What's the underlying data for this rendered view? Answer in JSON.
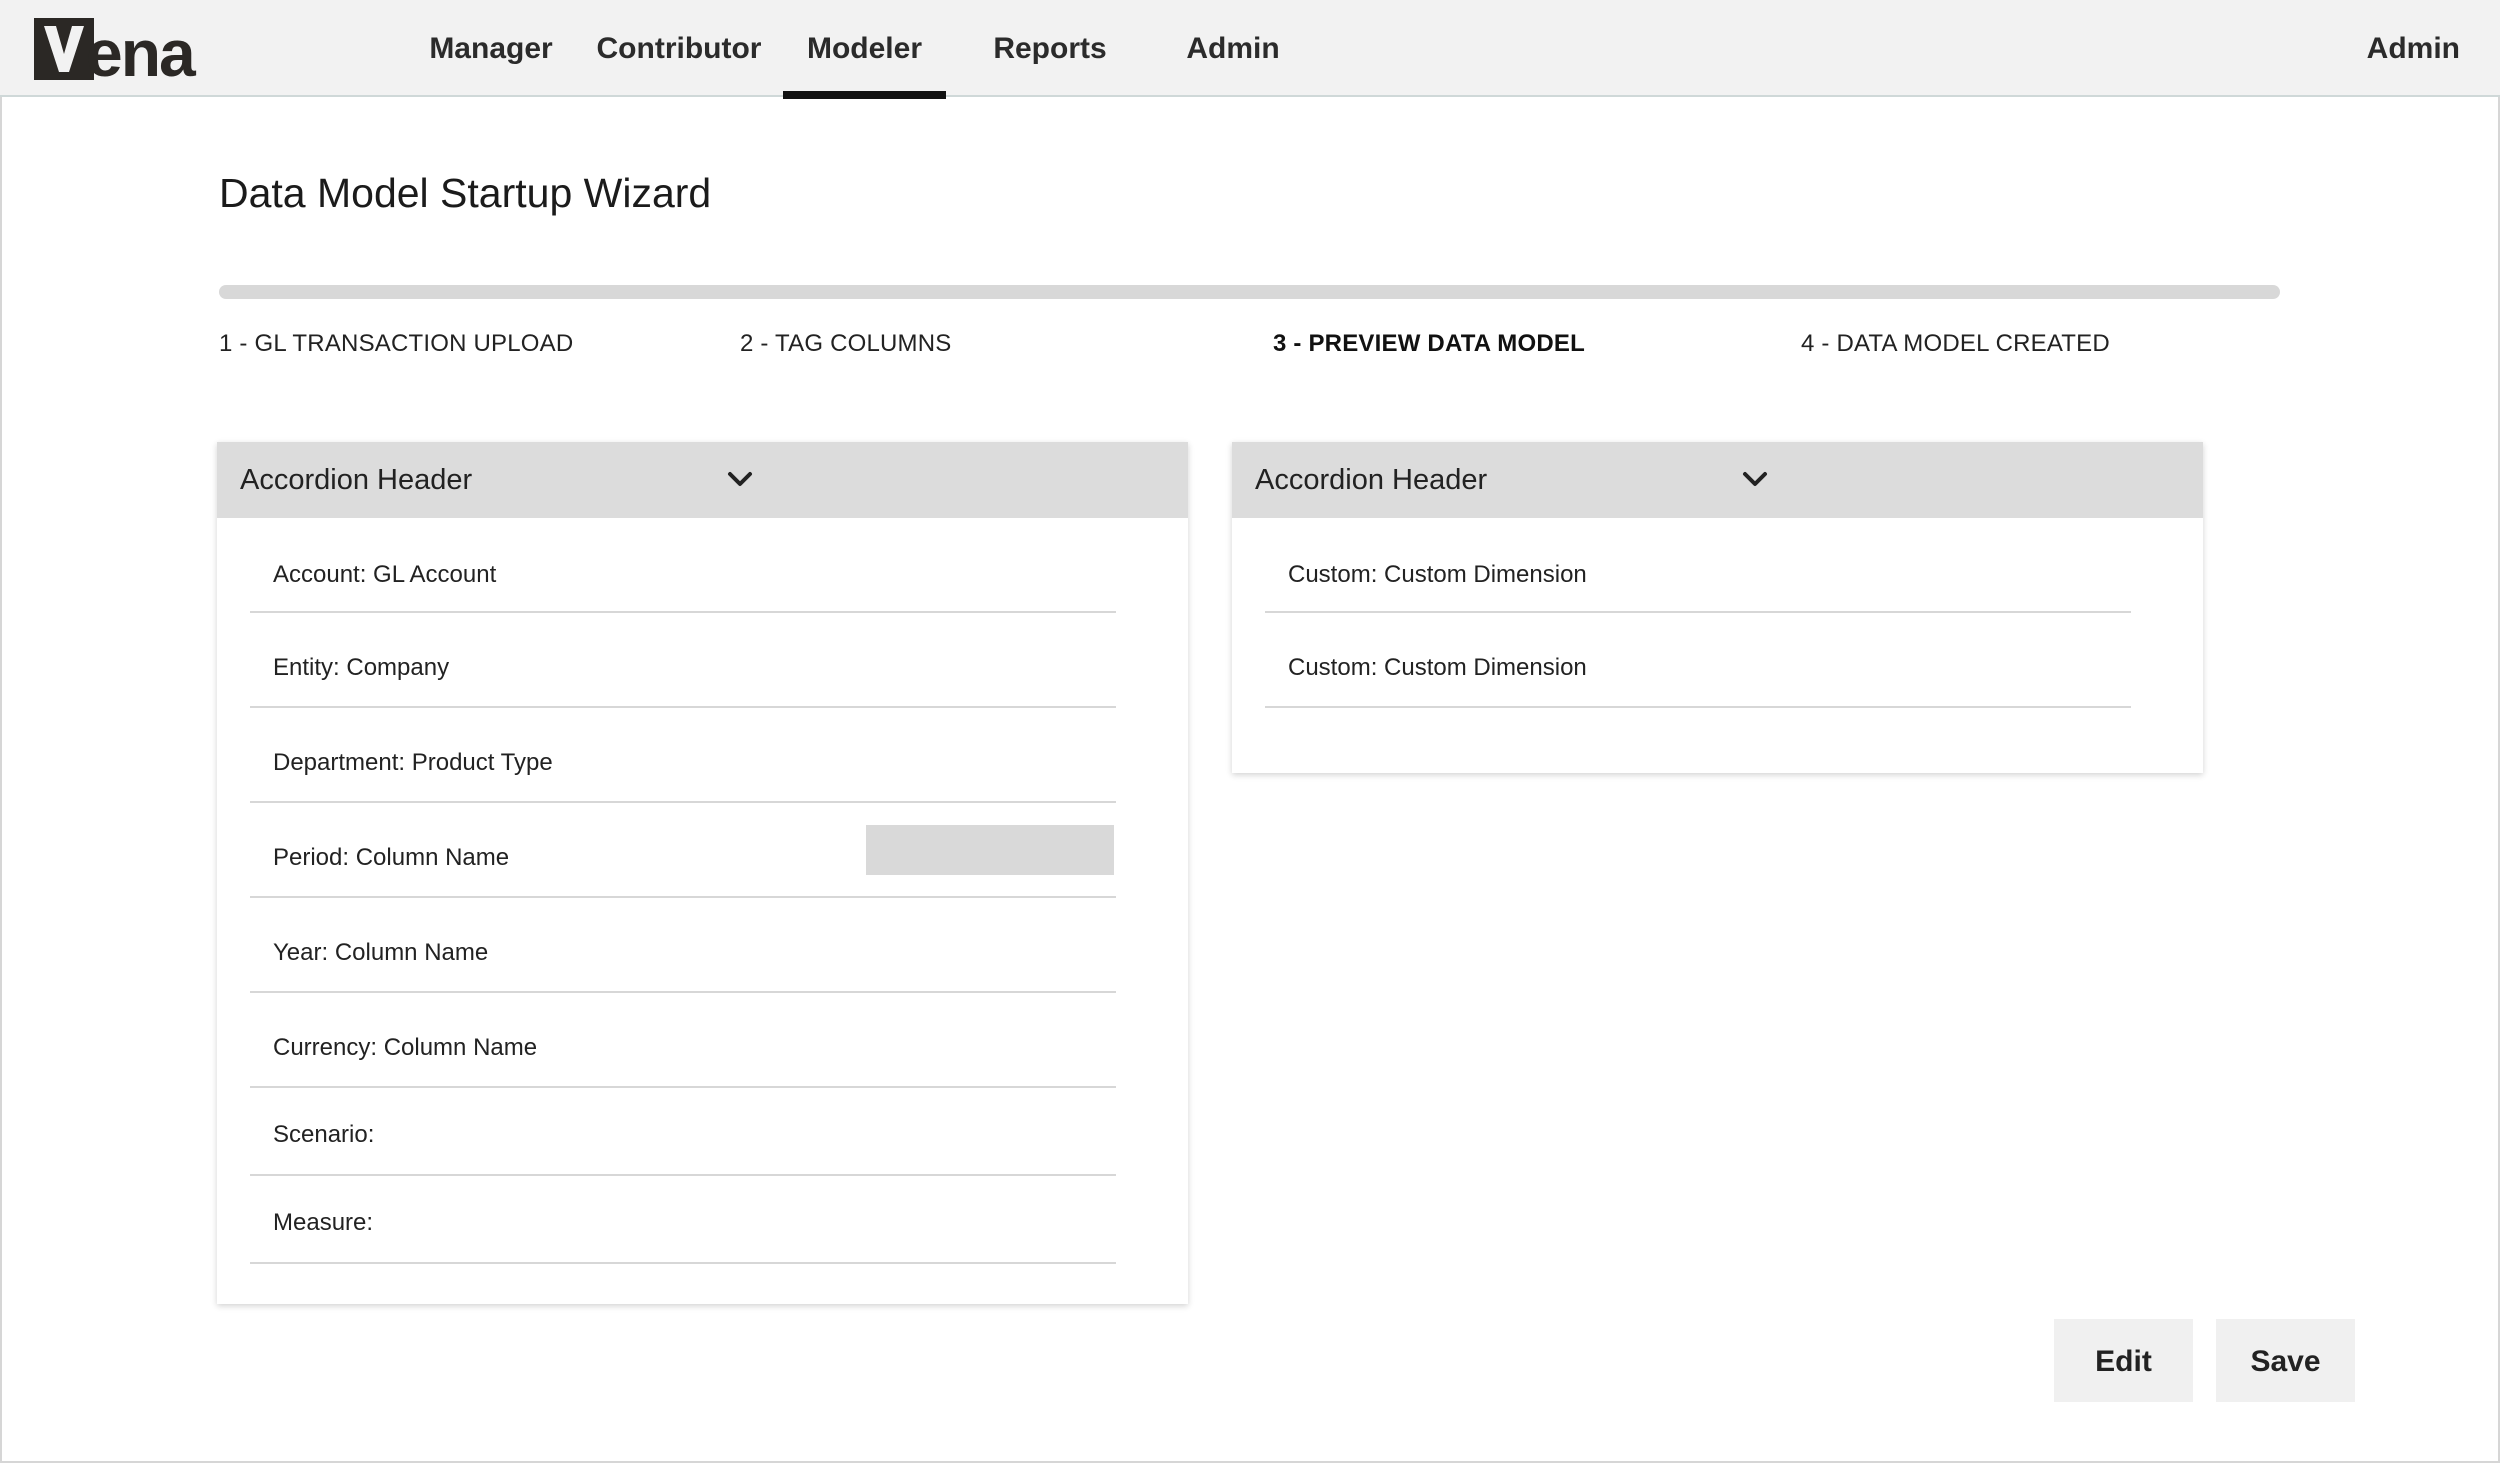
{
  "app": {
    "logo_text": "ena"
  },
  "nav": {
    "items": [
      {
        "label": "Manager"
      },
      {
        "label": "Contributor"
      },
      {
        "label": "Modeler"
      },
      {
        "label": "Reports"
      },
      {
        "label": "Admin"
      }
    ],
    "active": "Modeler",
    "user_label": "Admin"
  },
  "page": {
    "title": "Data Model Startup Wizard"
  },
  "steps": [
    {
      "label": "1 - GL TRANSACTION UPLOAD"
    },
    {
      "label": "2 - TAG COLUMNS"
    },
    {
      "label": "3 - PREVIEW DATA MODEL"
    },
    {
      "label": "4 - DATA MODEL CREATED"
    }
  ],
  "current_step": 3,
  "accordions": [
    {
      "header": "Accordion Header",
      "rows": [
        {
          "label": "Account: GL Account"
        },
        {
          "label": "Entity: Company"
        },
        {
          "label": "Department: Product Type"
        },
        {
          "label": "Period: Column Name"
        },
        {
          "label": "Year: Column Name"
        },
        {
          "label": "Currency: Column Name"
        },
        {
          "label": "Scenario:"
        },
        {
          "label": "Measure:"
        }
      ]
    },
    {
      "header": "Accordion Header",
      "rows": [
        {
          "label": "Custom: Custom Dimension"
        },
        {
          "label": "Custom: Custom Dimension"
        }
      ]
    }
  ],
  "actions": {
    "edit_label": "Edit",
    "save_label": "Save"
  },
  "colors": {
    "header_bg": "#f2f2f2",
    "accordion_header_bg": "#dcdcdc",
    "active_underline": "#111111",
    "button_bg": "#f0f0f0"
  }
}
